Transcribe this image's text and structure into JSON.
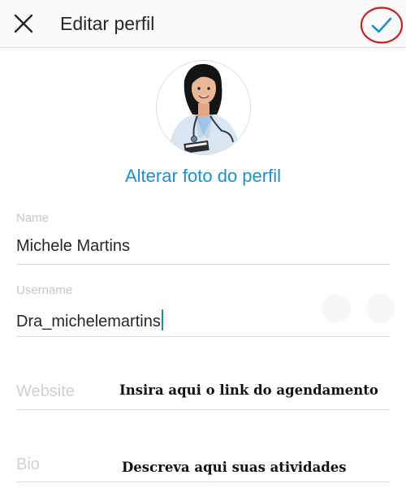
{
  "header": {
    "title": "Editar perfil",
    "close_icon": "close-icon",
    "confirm_icon": "checkmark-icon",
    "accent_color": "#1a8fd6",
    "highlight_color": "#cc1f1f"
  },
  "profile": {
    "change_photo_label": "Alterar foto do perfil"
  },
  "form": {
    "name": {
      "label": "Name",
      "value": "Michele Martins"
    },
    "username": {
      "label": "Username",
      "value": "Dra_michelemartins"
    },
    "website": {
      "placeholder": "Website",
      "annotation": "Insira aqui o link do agendamento"
    },
    "bio": {
      "placeholder": "Bio",
      "annotation": "Descreva aqui suas atividades"
    }
  }
}
